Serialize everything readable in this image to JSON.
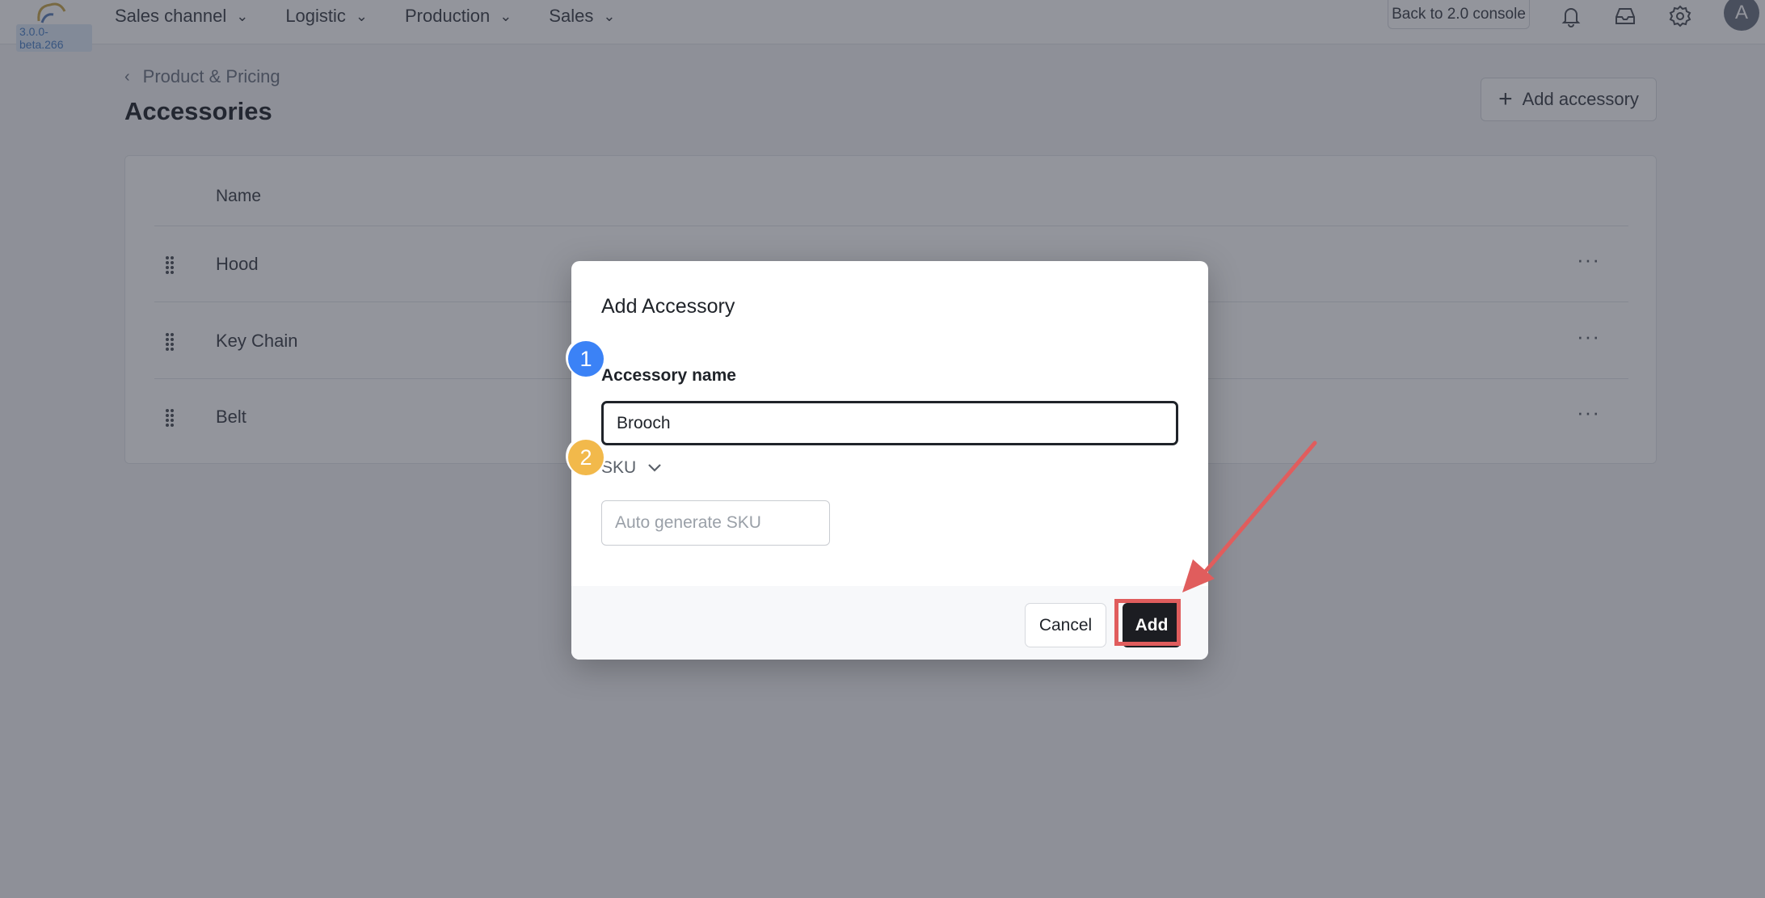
{
  "app": {
    "version": "3.0.0-beta.266",
    "avatar_initial": "A"
  },
  "nav": {
    "items": [
      {
        "label": "Sales channel"
      },
      {
        "label": "Logistic"
      },
      {
        "label": "Production"
      },
      {
        "label": "Sales"
      }
    ],
    "console_button": "Back to 2.0 console",
    "icons": [
      "bell-icon",
      "inbox-icon",
      "gear-icon"
    ]
  },
  "page": {
    "breadcrumb": "Product & Pricing",
    "title": "Accessories",
    "add_button": "Add accessory"
  },
  "table": {
    "header_name": "Name",
    "rows": [
      {
        "name": "Hood"
      },
      {
        "name": "Key Chain"
      },
      {
        "name": "Belt"
      }
    ]
  },
  "modal": {
    "title": "Add Accessory",
    "name_label": "Accessory name",
    "name_value": "Brooch",
    "sku_label": "SKU",
    "sku_placeholder": "Auto generate SKU",
    "cancel_label": "Cancel",
    "add_label": "Add"
  },
  "annotations": {
    "step1": "1",
    "step2": "2",
    "colors": {
      "step1": "#3b82f6",
      "step2": "#f2b94b",
      "highlight": "#e05d5d"
    }
  }
}
